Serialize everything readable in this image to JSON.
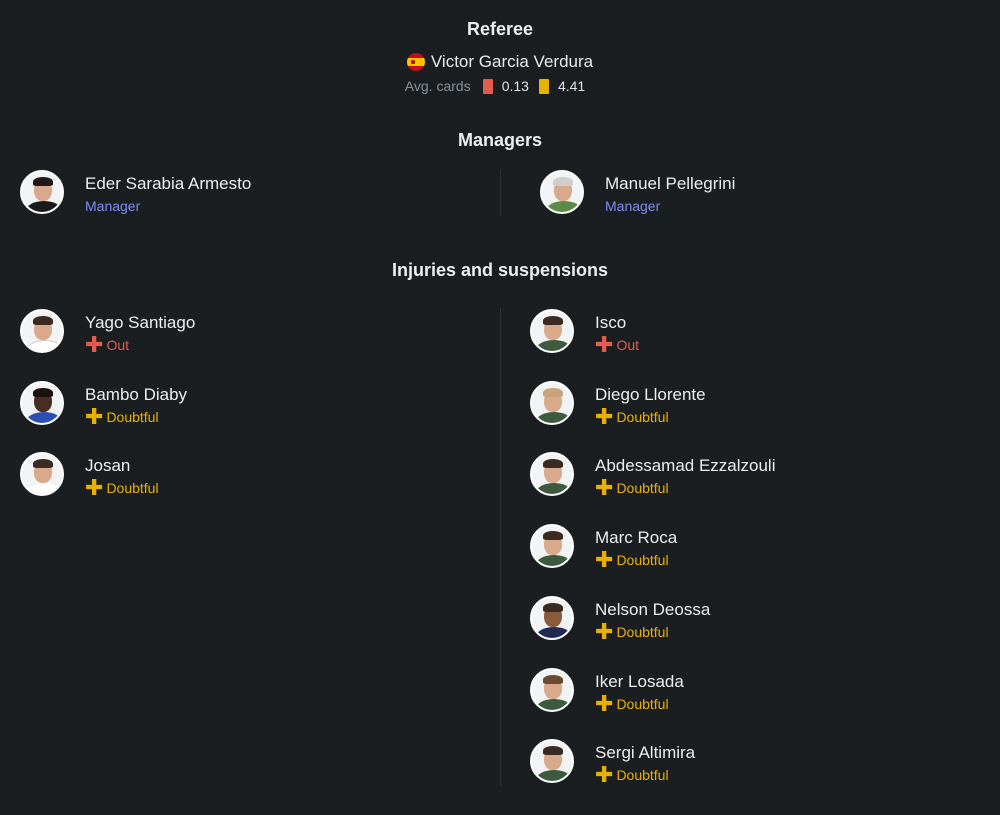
{
  "referee": {
    "title": "Referee",
    "flag_icon": "spain-flag-icon",
    "name": "Victor Garcia Verdura",
    "avg_cards_label": "Avg. cards",
    "red_avg": "0.13",
    "yellow_avg": "4.41"
  },
  "managers": {
    "title": "Managers",
    "home": {
      "name": "Eder Sarabia Armesto",
      "role": "Manager"
    },
    "away": {
      "name": "Manuel Pellegrini",
      "role": "Manager"
    }
  },
  "injuries": {
    "title": "Injuries and suspensions",
    "home": [
      {
        "name": "Yago Santiago",
        "status": "Out"
      },
      {
        "name": "Bambo Diaby",
        "status": "Doubtful"
      },
      {
        "name": "Josan",
        "status": "Doubtful"
      }
    ],
    "away": [
      {
        "name": "Isco",
        "status": "Out"
      },
      {
        "name": "Diego Llorente",
        "status": "Doubtful"
      },
      {
        "name": "Abdessamad Ezzalzouli",
        "status": "Doubtful"
      },
      {
        "name": "Marc Roca",
        "status": "Doubtful"
      },
      {
        "name": "Nelson Deossa",
        "status": "Doubtful"
      },
      {
        "name": "Iker Losada",
        "status": "Doubtful"
      },
      {
        "name": "Sergi Altimira",
        "status": "Doubtful"
      }
    ]
  },
  "colors": {
    "background": "#1b1e20",
    "out": "#e35c4f",
    "doubtful": "#e8b100",
    "manager_role": "#7b8cf0",
    "red_card": "#e35c4f",
    "yellow_card": "#e8b100"
  }
}
